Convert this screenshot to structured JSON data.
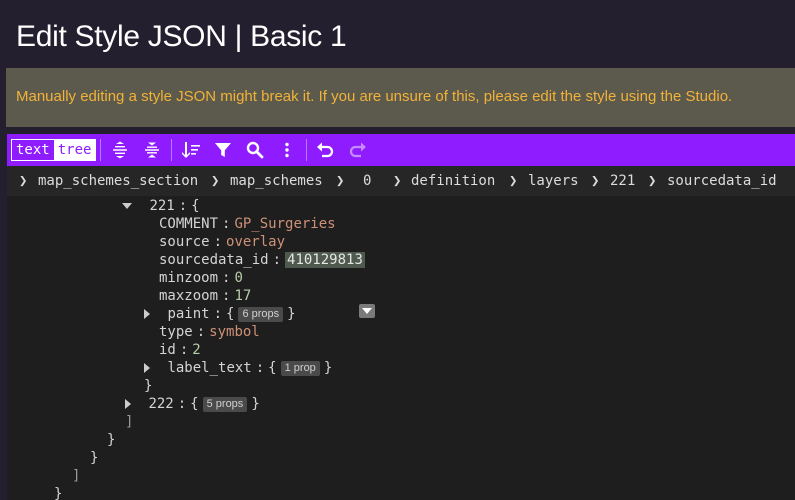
{
  "page": {
    "title": "Edit Style JSON | Basic 1",
    "warning": "Manually editing a style JSON might break it. If you are unsure of this, please edit the style using the Studio."
  },
  "toolbar": {
    "mode_text": "text",
    "mode_tree": "tree",
    "accent": "#8f1cff",
    "buttons": [
      "expand-all-icon",
      "collapse-all-icon",
      "sort-icon",
      "filter-icon",
      "search-icon",
      "more-icon",
      "undo-icon",
      "redo-icon"
    ]
  },
  "breadcrumb": [
    "map_schemes_section",
    "map_schemes",
    "0",
    "definition",
    "layers",
    "221",
    "sourcedata_id"
  ],
  "tree": {
    "node221": {
      "key": "221",
      "open": "{"
    },
    "comment": {
      "key": "COMMENT",
      "value": "GP_Surgeries"
    },
    "source": {
      "key": "source",
      "value": "overlay"
    },
    "sourcedata_id": {
      "key": "sourcedata_id",
      "value": "410129813"
    },
    "minzoom": {
      "key": "minzoom",
      "value": "0"
    },
    "maxzoom": {
      "key": "maxzoom",
      "value": "17"
    },
    "paint": {
      "key": "paint",
      "open": "{",
      "badge": "6 props",
      "close": "}"
    },
    "type": {
      "key": "type",
      "value": "symbol"
    },
    "id": {
      "key": "id",
      "value": "2"
    },
    "label_text": {
      "key": "label_text",
      "open": "{",
      "badge": "1 prop",
      "close": "}"
    },
    "close221": "}",
    "node222": {
      "key": "222",
      "open": "{",
      "badge": "5 props",
      "close": "}"
    },
    "close_layers": "]",
    "close_definition": "}",
    "close_item0": "}",
    "close_map_schemes": "]",
    "close_section": "}",
    "colon": ":"
  }
}
